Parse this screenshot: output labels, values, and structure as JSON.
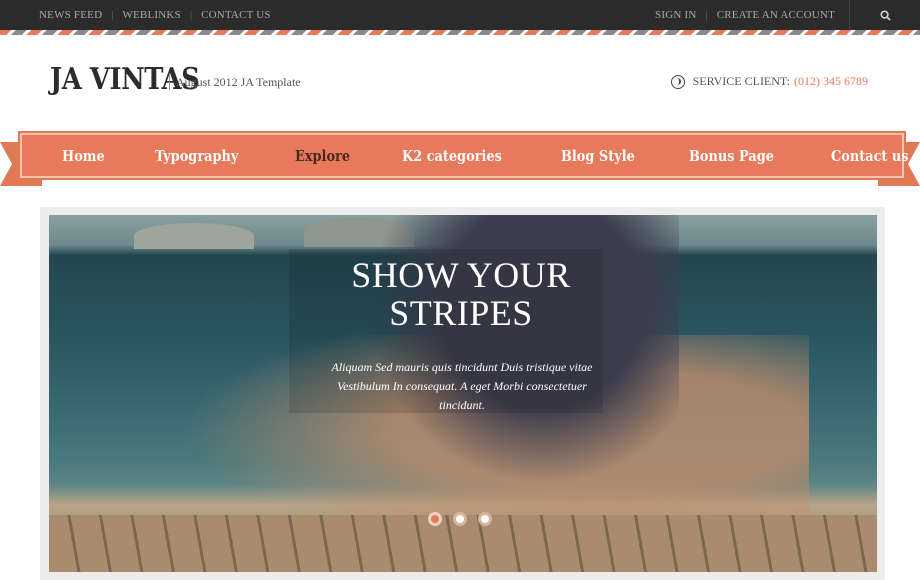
{
  "topbar": {
    "left_links": [
      "NEWS FEED",
      "WEBLINKS",
      "CONTACT US"
    ],
    "right_links": [
      "SIGN IN",
      "CREATE AN ACCOUNT"
    ],
    "search_icon": "search-icon"
  },
  "header": {
    "logo": "JA VINTAS",
    "tagline": "August 2012 JA Template",
    "service_label": "SERVICE CLIENT:",
    "service_phone": "(012) 345 6789",
    "phone_icon": "phone-icon"
  },
  "nav": {
    "items": [
      "Home",
      "Typography",
      "Explore",
      "K2 categories",
      "Blog Style",
      "Bonus Page",
      "Contact us"
    ],
    "active": "Explore"
  },
  "slider": {
    "title": "SHOW YOUR STRIPES",
    "text": "Aliquam Sed mauris quis tincidunt Duis tristique vitae Vestibulum In consequat. A eget Morbi consectetuer tincidunt.",
    "dots": 3,
    "active_dot": 1
  },
  "colors": {
    "accent": "#e8795a",
    "topbar": "#2b2b2b",
    "nav_active_text": "#4a2a1e"
  }
}
